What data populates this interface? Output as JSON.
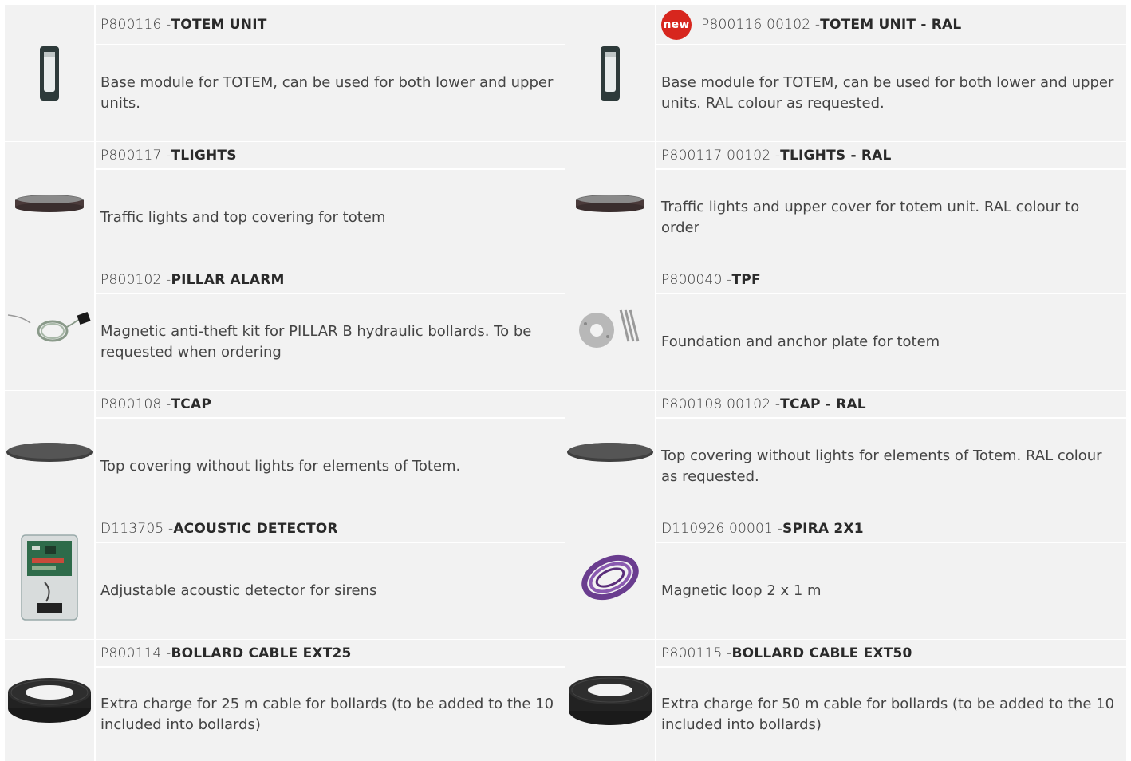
{
  "items": [
    {
      "code": "P800116 - ",
      "name": "TOTEM UNIT",
      "desc": "Base module for TOTEM, can be used for both lower and upper units.",
      "icon": "totem-unit-image"
    },
    {
      "badge": "new",
      "code": "P800116 00102 - ",
      "name": "TOTEM UNIT - RAL",
      "desc": "Base module for TOTEM, can be used for both lower and upper units. RAL colour as requested.",
      "icon": "totem-unit-image"
    },
    {
      "code": "P800117 - ",
      "name": "TLIGHTS",
      "desc": "Traffic lights and top covering for totem",
      "icon": "traffic-lights-image"
    },
    {
      "code": "P800117 00102 - ",
      "name": "TLIGHTS - RAL",
      "desc": "Traffic lights and upper cover for totem unit. RAL colour to order",
      "icon": "traffic-lights-image"
    },
    {
      "code": "P800102 - ",
      "name": "PILLAR ALARM",
      "desc": "Magnetic anti-theft kit for PILLAR B hydraulic bollards. To be requested when ordering",
      "icon": "pillar-alarm-image"
    },
    {
      "code": "P800040 - ",
      "name": "TPF",
      "desc": "Foundation and anchor plate for totem",
      "icon": "anchor-plate-image"
    },
    {
      "code": "P800108 - ",
      "name": "TCAP",
      "desc": "Top covering without lights for elements of Totem.",
      "icon": "top-cap-image"
    },
    {
      "code": "P800108 00102 - ",
      "name": "TCAP - RAL",
      "desc": "Top covering without lights for elements of Totem. RAL colour as requested.",
      "icon": "top-cap-image"
    },
    {
      "code": "D113705 - ",
      "name": "ACOUSTIC DETECTOR",
      "desc": "Adjustable acoustic detector for sirens",
      "icon": "acoustic-detector-image"
    },
    {
      "code": "D110926 00001 - ",
      "name": "SPIRA 2X1",
      "desc": "Magnetic loop 2 x 1 m",
      "icon": "magnetic-loop-image"
    },
    {
      "code": "P800114 - ",
      "name": "BOLLARD CABLE EXT25",
      "desc": "Extra charge for 25 m cable for bollards (to be added to the 10 included into bollards)",
      "icon": "cable-coil-image"
    },
    {
      "code": "P800115 - ",
      "name": "BOLLARD CABLE EXT50",
      "desc": "Extra charge for 50 m cable for bollards (to be added to the 10 included into bollards)",
      "icon": "cable-coil-image"
    }
  ],
  "colors": {
    "cell_bg": "#f2f2f2",
    "badge": "#d7261e",
    "text": "#444444"
  }
}
